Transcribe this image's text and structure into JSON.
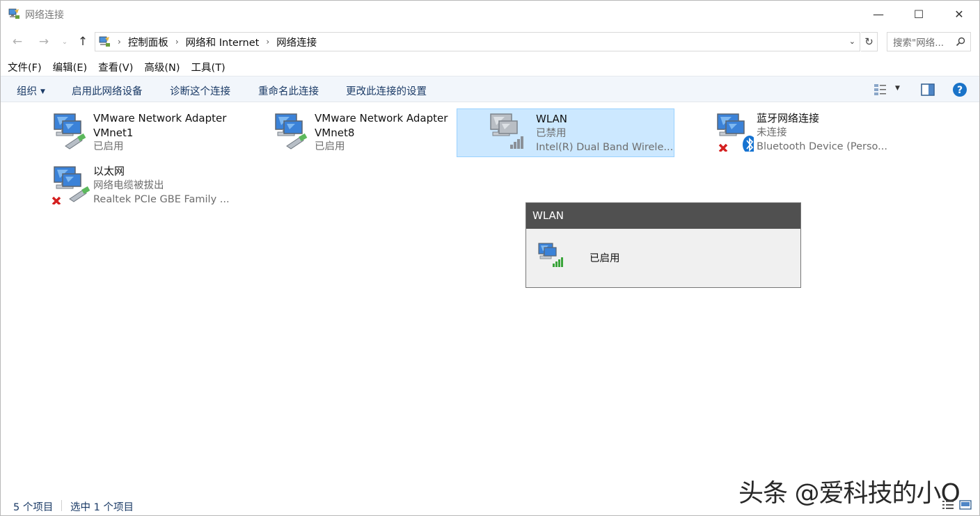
{
  "window": {
    "title": "网络连接",
    "controls": {
      "minimize": "—",
      "maximize": "☐",
      "close": "✕"
    }
  },
  "nav": {
    "back": "←",
    "forward": "→",
    "recent": "⌄",
    "up": "↑",
    "breadcrumb": [
      "控制面板",
      "网络和 Internet",
      "网络连接"
    ],
    "refresh": "↻",
    "search_placeholder": "搜索\"网络..."
  },
  "menu": [
    "文件(F)",
    "编辑(E)",
    "查看(V)",
    "高级(N)",
    "工具(T)"
  ],
  "commands": {
    "organize": "组织",
    "enable": "启用此网络设备",
    "diagnose": "诊断这个连接",
    "rename": "重命名此连接",
    "settings": "更改此连接的设置"
  },
  "items": [
    {
      "name": "VMware Network Adapter",
      "name2": "VMnet1",
      "status": "已启用",
      "device": "",
      "icon": "ethernet-adapter-icon"
    },
    {
      "name": "VMware Network Adapter",
      "name2": "VMnet8",
      "status": "已启用",
      "device": "",
      "icon": "ethernet-adapter-icon"
    },
    {
      "name": "WLAN",
      "status": "已禁用",
      "device": "Intel(R) Dual Band Wirele...",
      "icon": "wlan-disabled-icon",
      "selected": true
    },
    {
      "name": "蓝牙网络连接",
      "status": "未连接",
      "device": "Bluetooth Device (Perso...",
      "icon": "bluetooth-adapter-icon"
    },
    {
      "name": "以太网",
      "status": "网络电缆被拔出",
      "device": "Realtek PCIe GBE Family ...",
      "icon": "ethernet-unplugged-icon"
    }
  ],
  "tooltip": {
    "title": "WLAN",
    "status": "已启用"
  },
  "statusbar": {
    "count": "5 个项目",
    "selected": "选中 1 个项目"
  },
  "watermark": "头条 @爱科技的小O",
  "colors": {
    "selection_bg": "#cce8ff",
    "selection_border": "#99d1ff",
    "command_bar": "#f2f6fb",
    "tooltip_header": "#505050",
    "help_blue": "#1a73c8"
  }
}
